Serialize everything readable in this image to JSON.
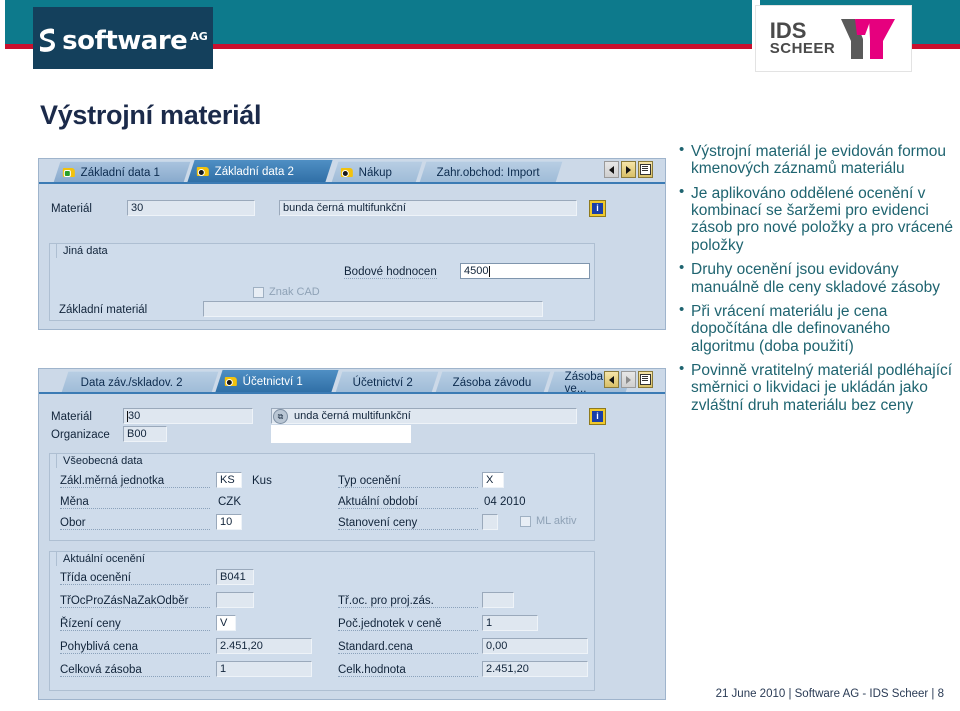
{
  "header": {
    "brand_logo_text": "software",
    "brand_logo_suffix": "AG",
    "partner_logo_line1": "IDS",
    "partner_logo_line2": "SCHEER",
    "teal_color": "#0d7a8c",
    "red_color": "#c8102e",
    "navy_color": "#14405c",
    "magenta_color": "#e6007e"
  },
  "slide": {
    "title": "Výstrojní materiál"
  },
  "screenshot": {
    "window1": {
      "tabs": [
        {
          "label": "Základní data 1",
          "icon": "folder-check-icon",
          "active": false
        },
        {
          "label": "Základní data 2",
          "icon": "folder-dot-icon",
          "active": true
        },
        {
          "label": "Nákup",
          "icon": "folder-dot-icon",
          "active": false
        },
        {
          "label": "Zahr.obchod: Import",
          "icon": "none",
          "active": false
        }
      ],
      "nav": {
        "prev": "◀",
        "next": "▶",
        "list": "list-icon"
      },
      "material_label": "Materiál",
      "material_value": "30",
      "material_desc": "bunda černá multifunkční",
      "info_button": "i",
      "group": {
        "title": "Jiná data",
        "score_label": "Bodové hodnocen",
        "score_value": "4500",
        "cad_checkbox_label": "Znak CAD",
        "cad_checked": false,
        "base_material_label": "Základní materiál",
        "base_material_value": ""
      }
    },
    "window2": {
      "tabs": [
        {
          "label": "Data záv./skladov. 2",
          "icon": "none",
          "active": false
        },
        {
          "label": "Účetnictví 1",
          "icon": "folder-dot-icon",
          "active": true
        },
        {
          "label": "Účetnictví 2",
          "icon": "none",
          "active": false
        },
        {
          "label": "Zásoba závodu",
          "icon": "none",
          "active": false
        },
        {
          "label": "Zásoba ve...",
          "icon": "none",
          "active": false
        }
      ],
      "nav": {
        "prev": "◀",
        "next": "▶",
        "list": "list-icon"
      },
      "material_label": "Materiál",
      "material_value": "30",
      "material_desc": "unda černá multifunkční",
      "org_label": "Organizace",
      "org_value": "B00",
      "info_button": "i",
      "general": {
        "title": "Všeobecná data",
        "rows_left": [
          {
            "label": "Zákl.měrná jednotka",
            "value": "KS",
            "extra": "Kus"
          },
          {
            "label": "Měna",
            "value": "CZK",
            "extra": ""
          },
          {
            "label": "Obor",
            "value": "10",
            "extra": ""
          }
        ],
        "rows_right": [
          {
            "label": "Typ ocenění",
            "value": "X",
            "extra": ""
          },
          {
            "label": "Aktuální období",
            "value": "",
            "extra": "04  2010"
          },
          {
            "label": "Stanovení ceny",
            "value": "",
            "extra": ""
          }
        ],
        "ml_checkbox_label": "ML aktiv",
        "ml_checked": false
      },
      "valuation": {
        "title": "Aktuální ocenění",
        "rows": [
          {
            "label_l": "Třída ocenění",
            "value_l": "B041",
            "label_r": "",
            "value_r": ""
          },
          {
            "label_l": "TřOcProZásNaZakOdběr",
            "value_l": "",
            "label_r": "Tř.oc. pro proj.zás.",
            "value_r": ""
          },
          {
            "label_l": "Řízení ceny",
            "value_l": "V",
            "label_r": "Poč.jednotek v ceně",
            "value_r": "1"
          },
          {
            "label_l": "Pohyblivá cena",
            "value_l": "2.451,20",
            "label_r": "Standard.cena",
            "value_r": "0,00"
          },
          {
            "label_l": "Celková zásoba",
            "value_l": "1",
            "label_r": "Celk.hodnota",
            "value_r": "2.451,20"
          }
        ]
      }
    }
  },
  "bullets": [
    "Výstrojní materiál je evidován formou kmenových záznamů materiálu",
    "Je aplikováno oddělené ocenění v kombinací se šaržemi pro evidenci zásob pro nové položky a pro vrácené položky",
    "Druhy ocenění jsou evidovány manuálně dle ceny skladové zásoby",
    "Při vrácení materiálu je cena dopočítána dle definovaného algoritmu (doba použití)",
    "Povinně vratitelný materiál podléhající směrnici o likvidaci je ukládán jako zvláštní druh materiálu bez ceny"
  ],
  "footer": {
    "text": "21 June 2010  |  Software AG - IDS Scheer  |  8"
  }
}
